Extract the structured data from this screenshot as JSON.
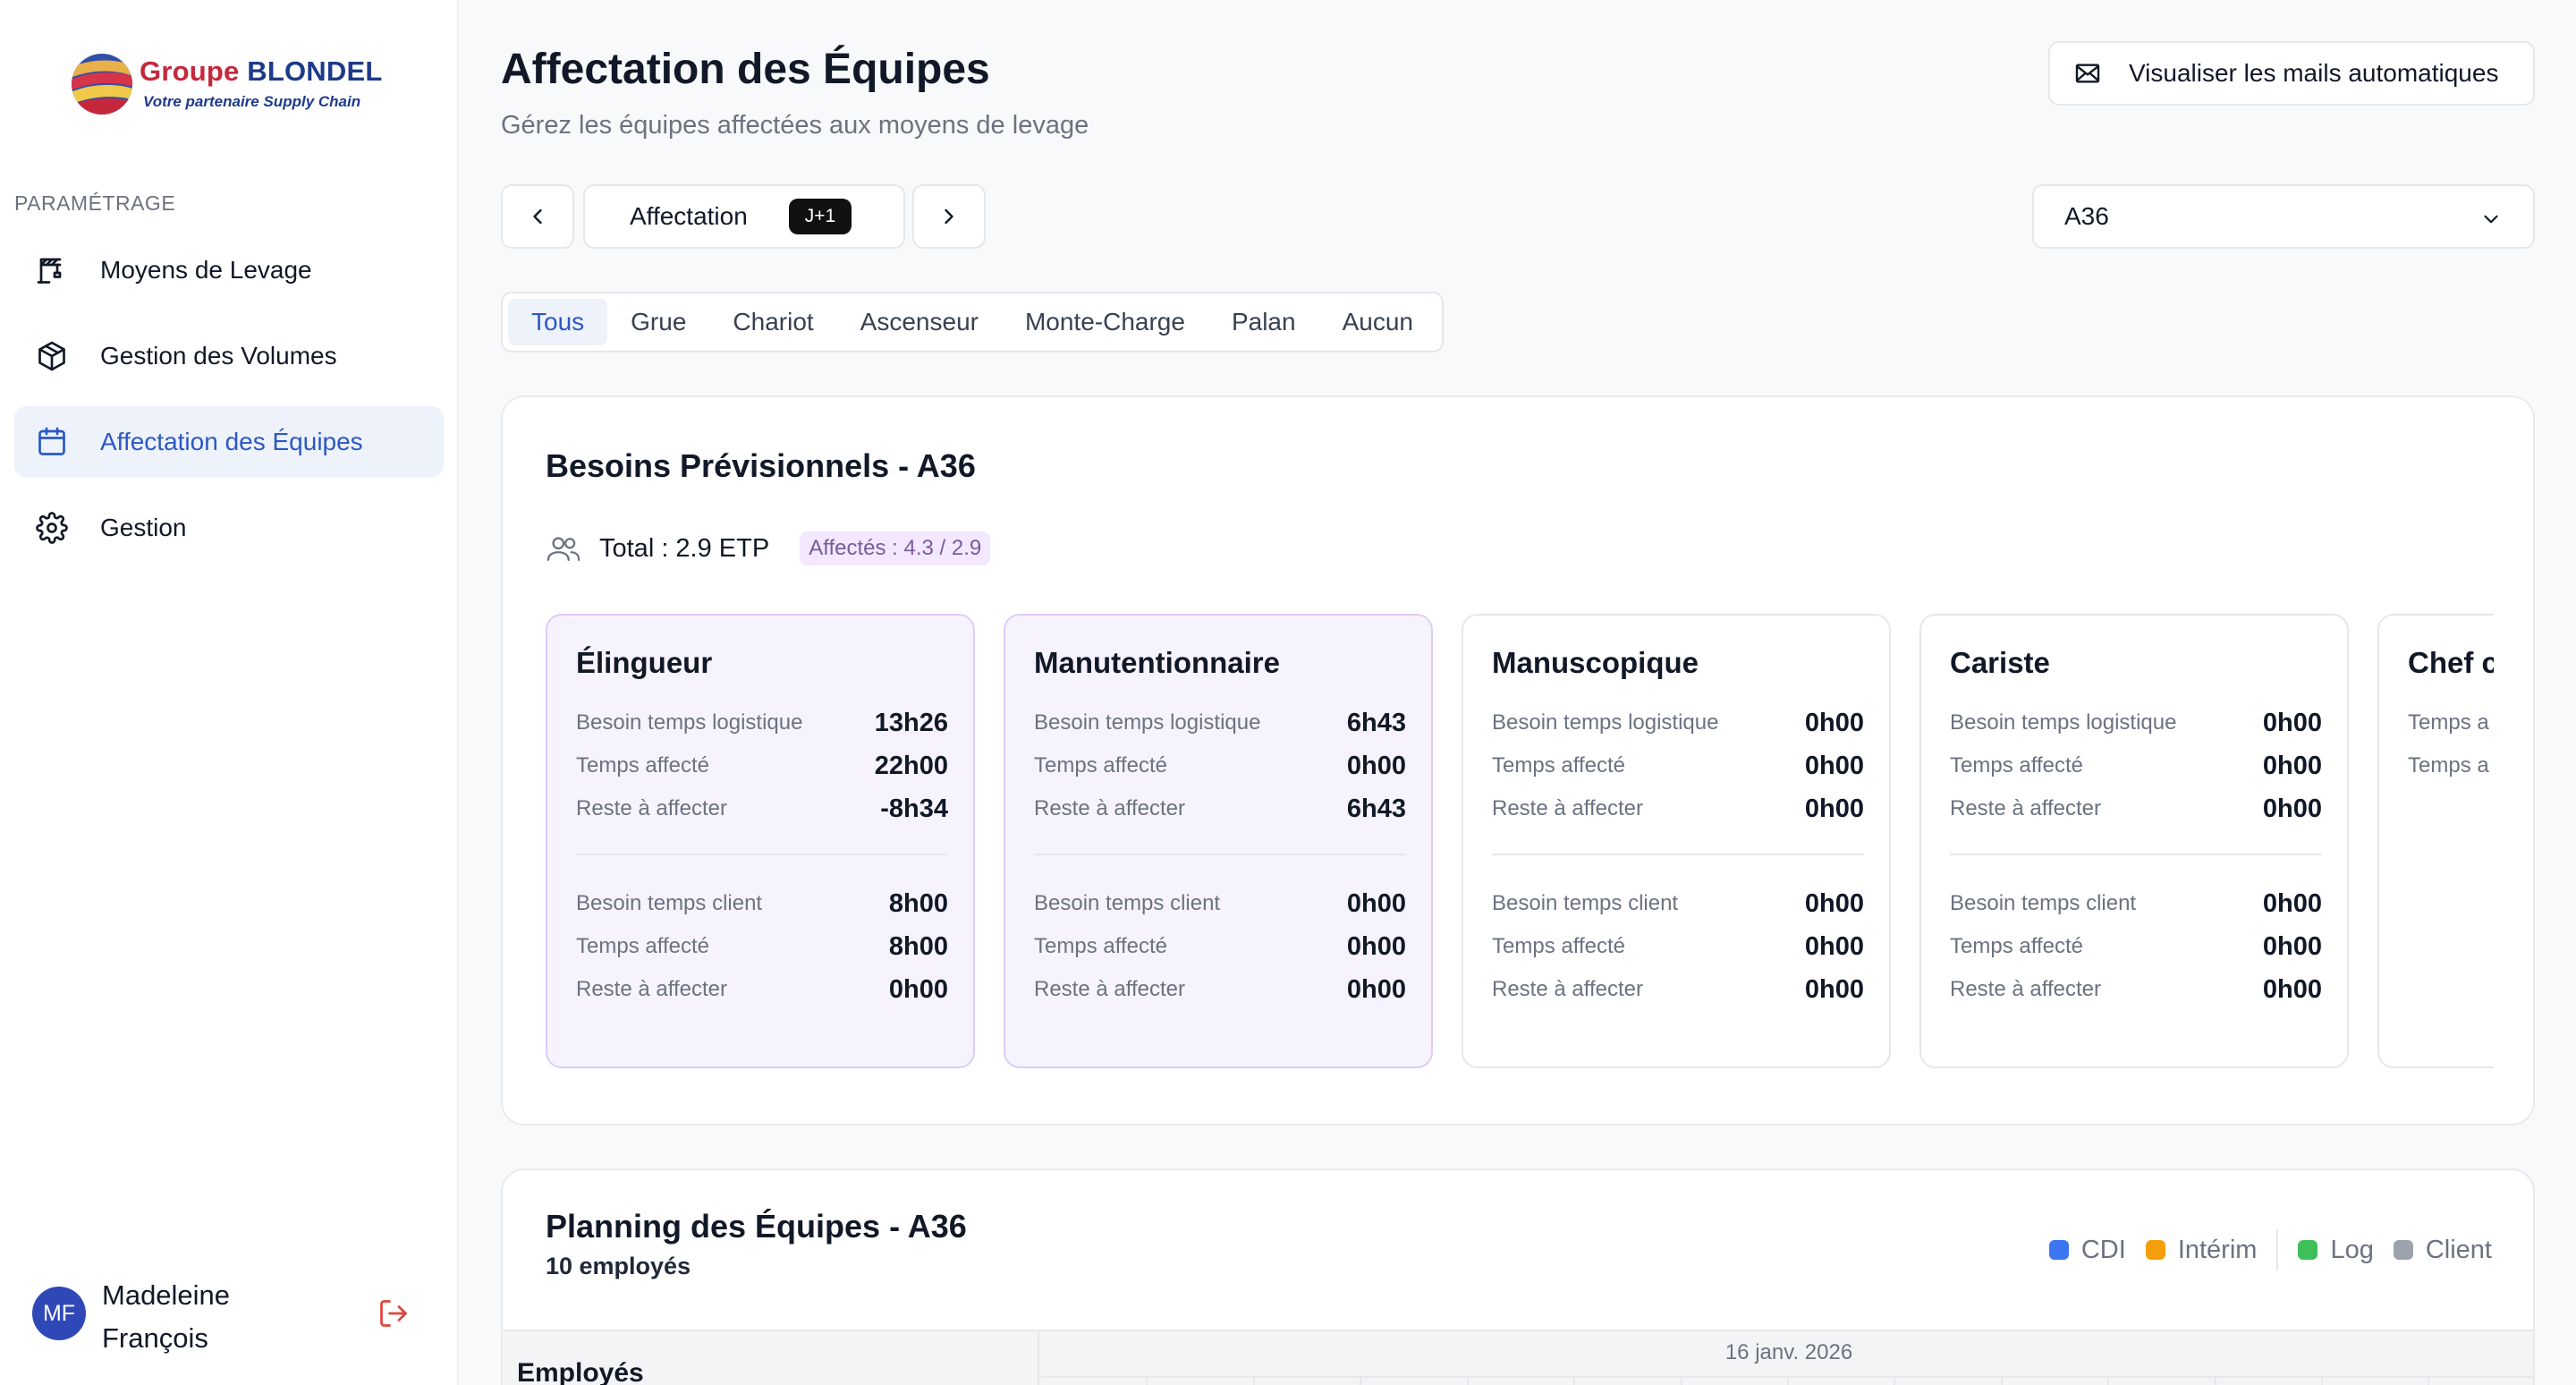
{
  "brand": {
    "name_part1": "Groupe",
    "name_part2": "BLONDEL",
    "tagline": "Votre partenaire Supply Chain"
  },
  "sidebar": {
    "section_title": "PARAMÉTRAGE",
    "items": [
      {
        "label": "Moyens de Levage",
        "icon": "crane-icon",
        "active": false
      },
      {
        "label": "Gestion des Volumes",
        "icon": "package-icon",
        "active": false
      },
      {
        "label": "Affectation des Équipes",
        "icon": "calendar-icon",
        "active": true
      },
      {
        "label": "Gestion",
        "icon": "gear-icon",
        "active": false
      }
    ],
    "user": {
      "initials": "MF",
      "name": "Madeleine François"
    }
  },
  "header": {
    "title": "Affectation des Équipes",
    "subtitle": "Gérez les équipes affectées aux moyens de levage",
    "mail_button": "Visualiser les mails automatiques"
  },
  "toolbar": {
    "day_label": "Affectation",
    "day_badge": "J+1",
    "selected_site": "A36"
  },
  "tabs": [
    "Tous",
    "Grue",
    "Chariot",
    "Ascenseur",
    "Monte-Charge",
    "Palan",
    "Aucun"
  ],
  "active_tab": "Tous",
  "needs": {
    "title": "Besoins Prévisionnels - A36",
    "total": "Total : 2.9 ETP",
    "affected": "Affectés : 4.3 / 2.9",
    "roles": [
      {
        "name": "Élingueur",
        "highlighted": true,
        "rows": [
          {
            "label": "Besoin temps logistique",
            "value": "13h26"
          },
          {
            "label": "Temps affecté",
            "value": "22h00"
          },
          {
            "label": "Reste à affecter",
            "value": "-8h34"
          },
          {
            "label": "Besoin temps client",
            "value": "8h00"
          },
          {
            "label": "Temps affecté",
            "value": "8h00"
          },
          {
            "label": "Reste à affecter",
            "value": "0h00"
          }
        ]
      },
      {
        "name": "Manutentionnaire",
        "highlighted": true,
        "rows": [
          {
            "label": "Besoin temps logistique",
            "value": "6h43"
          },
          {
            "label": "Temps affecté",
            "value": "0h00"
          },
          {
            "label": "Reste à affecter",
            "value": "6h43"
          },
          {
            "label": "Besoin temps client",
            "value": "0h00"
          },
          {
            "label": "Temps affecté",
            "value": "0h00"
          },
          {
            "label": "Reste à affecter",
            "value": "0h00"
          }
        ]
      },
      {
        "name": "Manuscopique",
        "highlighted": false,
        "rows": [
          {
            "label": "Besoin temps logistique",
            "value": "0h00"
          },
          {
            "label": "Temps affecté",
            "value": "0h00"
          },
          {
            "label": "Reste à affecter",
            "value": "0h00"
          },
          {
            "label": "Besoin temps client",
            "value": "0h00"
          },
          {
            "label": "Temps affecté",
            "value": "0h00"
          },
          {
            "label": "Reste à affecter",
            "value": "0h00"
          }
        ]
      },
      {
        "name": "Cariste",
        "highlighted": false,
        "rows": [
          {
            "label": "Besoin temps logistique",
            "value": "0h00"
          },
          {
            "label": "Temps affecté",
            "value": "0h00"
          },
          {
            "label": "Reste à affecter",
            "value": "0h00"
          },
          {
            "label": "Besoin temps client",
            "value": "0h00"
          },
          {
            "label": "Temps affecté",
            "value": "0h00"
          },
          {
            "label": "Reste à affecter",
            "value": "0h00"
          }
        ]
      },
      {
        "name": "Chef c",
        "highlighted": false,
        "rows": [
          {
            "label": "Temps a",
            "value": ""
          },
          {
            "label": "Temps a",
            "value": ""
          }
        ]
      }
    ]
  },
  "planning": {
    "title": "Planning des Équipes - A36",
    "subtitle": "10 employés",
    "legend": [
      {
        "label": "CDI",
        "color": "#3b76f0"
      },
      {
        "label": "Intérim",
        "color": "#f59e0b"
      },
      {
        "label": "Log",
        "color": "#3fbf5a"
      },
      {
        "label": "Client",
        "color": "#9ca3af"
      }
    ],
    "employees_header": "Employés",
    "date": "16 janv. 2026"
  }
}
